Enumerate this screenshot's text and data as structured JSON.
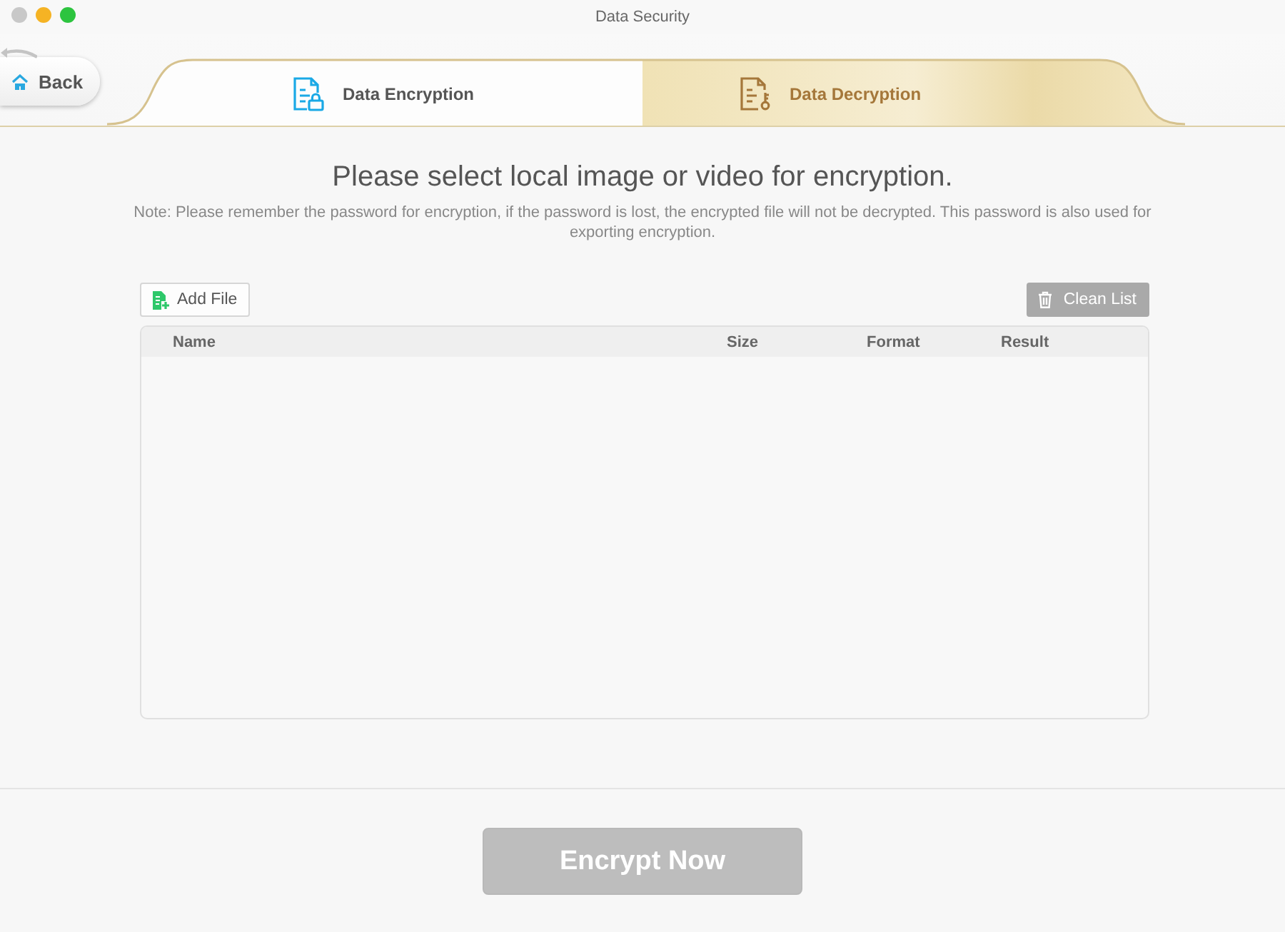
{
  "window": {
    "title": "Data Security"
  },
  "back_button": {
    "label": "Back"
  },
  "tabs": [
    {
      "label": "Data Encryption",
      "selected": true
    },
    {
      "label": "Data Decryption",
      "selected": false
    }
  ],
  "heading": "Please select local image or video for encryption.",
  "note": "Note: Please remember the password for encryption, if the password is lost, the encrypted file will not be decrypted. This password is also used for exporting encryption.",
  "toolbar": {
    "add_file": {
      "label": "Add File"
    },
    "clean_list": {
      "label": "Clean List",
      "disabled": true
    }
  },
  "table": {
    "columns": [
      "Name",
      "Size",
      "Format",
      "Result"
    ]
  },
  "encrypt_button": {
    "label": "Encrypt Now",
    "disabled": true
  }
}
